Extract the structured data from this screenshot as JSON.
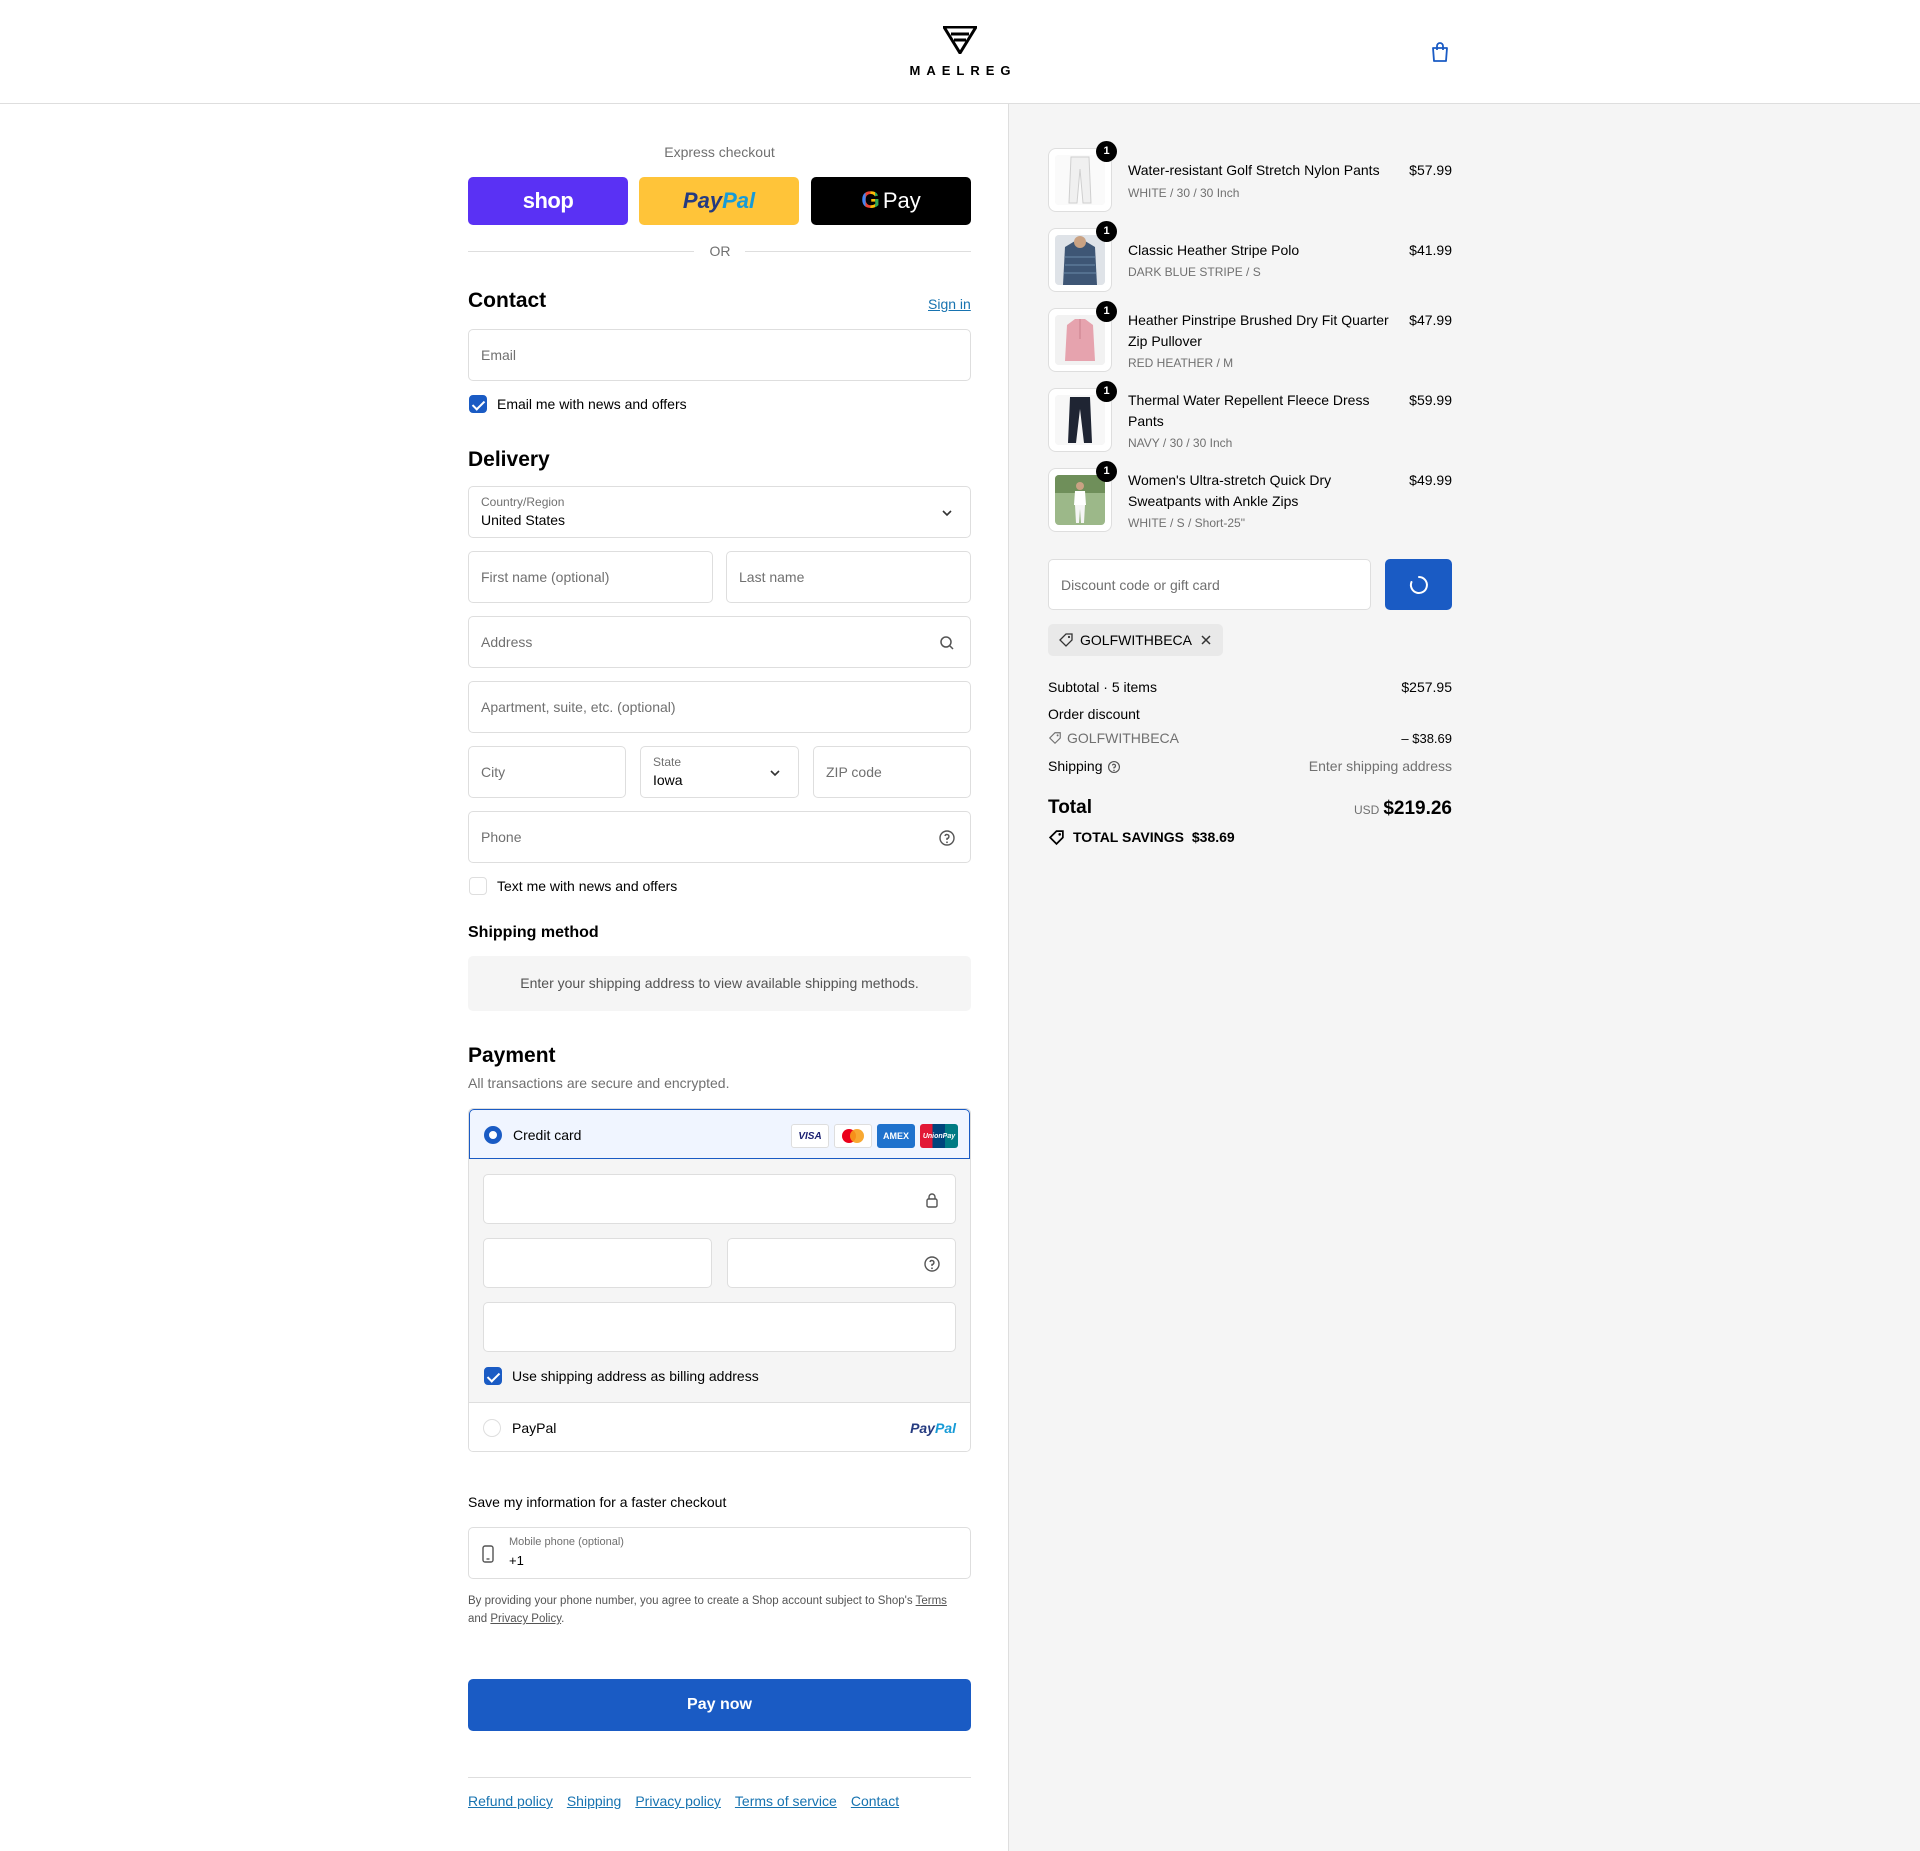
{
  "header": {
    "brand": "MAELREG",
    "cart_icon": "shopping-bag-icon"
  },
  "express": {
    "title": "Express checkout",
    "shop_label": "shop",
    "paypal_a": "Pay",
    "paypal_b": "Pal",
    "gpay_g": "G",
    "gpay_label": "Pay",
    "or": "OR"
  },
  "contact": {
    "title": "Contact",
    "sign_in": "Sign in",
    "email_placeholder": "Email",
    "news_label": "Email me with news and offers",
    "news_checked": true
  },
  "delivery": {
    "title": "Delivery",
    "country_label": "Country/Region",
    "country_value": "United States",
    "first_name": "First name (optional)",
    "last_name": "Last name",
    "address": "Address",
    "apartment": "Apartment, suite, etc. (optional)",
    "city": "City",
    "state_label": "State",
    "state_value": "Iowa",
    "zip": "ZIP code",
    "phone": "Phone",
    "text_label": "Text me with news and offers",
    "text_checked": false
  },
  "shipping_method": {
    "title": "Shipping method",
    "message": "Enter your shipping address to view available shipping methods."
  },
  "payment": {
    "title": "Payment",
    "subtitle": "All transactions are secure and encrypted.",
    "credit_card": "Credit card",
    "cards": [
      "VISA",
      "MC",
      "AMEX",
      "UnionPay"
    ],
    "billing_label": "Use shipping address as billing address",
    "paypal_label": "PayPal",
    "paypal_logo_a": "Pay",
    "paypal_logo_b": "Pal"
  },
  "save_info": {
    "title": "Save my information for a faster checkout",
    "mobile_label": "Mobile phone (optional)",
    "mobile_value": "+1",
    "legal_1": "By providing your phone number, you agree to create a Shop account subject to Shop's",
    "terms": "Terms",
    "legal_and": "and",
    "privacy": "Privacy Policy",
    "legal_end": "."
  },
  "pay_now": "Pay now",
  "footer_links": [
    "Refund policy",
    "Shipping",
    "Privacy policy",
    "Terms of service",
    "Contact"
  ],
  "cart": {
    "items": [
      {
        "name": "Water-resistant Golf Stretch Nylon Pants",
        "variant": "WHITE / 30 / 30 Inch",
        "price": "$57.99",
        "qty": "1",
        "color": "#f2f2f2"
      },
      {
        "name": "Classic Heather Stripe Polo",
        "variant": "DARK BLUE STRIPE / S",
        "price": "$41.99",
        "qty": "1",
        "color": "#3e5675"
      },
      {
        "name": "Heather Pinstripe Brushed Dry Fit Quarter Zip Pullover",
        "variant": "RED HEATHER / M",
        "price": "$47.99",
        "qty": "1",
        "color": "#e6a3ae"
      },
      {
        "name": "Thermal Water Repellent Fleece Dress Pants",
        "variant": "NAVY / 30 / 30 Inch",
        "price": "$59.99",
        "qty": "1",
        "color": "#1f2533"
      },
      {
        "name": "Women's Ultra-stretch Quick Dry Sweatpants with Ankle Zips",
        "variant": "WHITE / S / Short-25\"",
        "price": "$49.99",
        "qty": "1",
        "color": "#7d9a63"
      }
    ],
    "discount_placeholder": "Discount code or gift card",
    "applied_code": "GOLFWITHBECA",
    "subtotal_label": "Subtotal · 5 items",
    "subtotal_value": "$257.95",
    "order_discount_label": "Order discount",
    "discount_code": "GOLFWITHBECA",
    "discount_value": "– $38.69",
    "shipping_label": "Shipping",
    "shipping_value": "Enter shipping address",
    "total_label": "Total",
    "currency": "USD",
    "total_value": "$219.26",
    "savings_label": "TOTAL SAVINGS",
    "savings_value": "$38.69"
  },
  "colors": {
    "accent": "#1a5bc4",
    "shop": "#5a31f4",
    "paypal": "#ffc439",
    "link": "#1773b0"
  }
}
